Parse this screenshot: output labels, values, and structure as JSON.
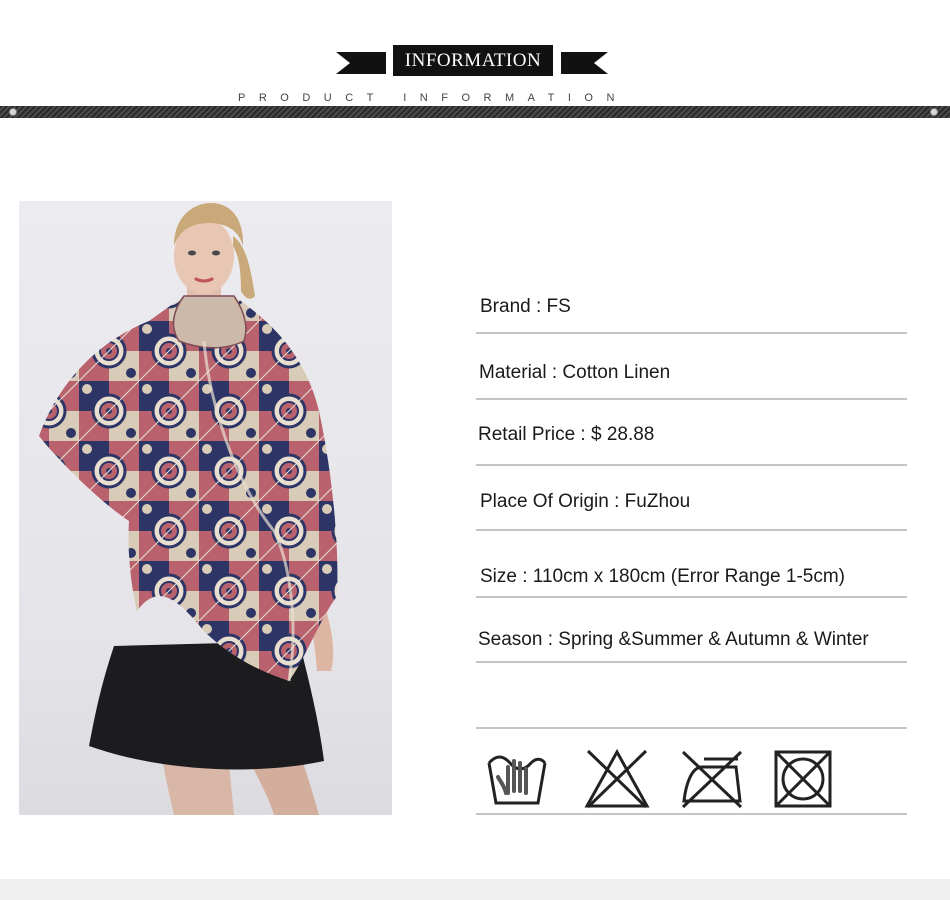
{
  "header": {
    "banner_title": "INFORMATION",
    "subtitle": "PRODUCT   INFORMATION"
  },
  "product_photo": {
    "description_icon": "model-wearing-scarf-image",
    "colors": {
      "navy": "#2d3566",
      "rose": "#b9626e",
      "cream": "#d8cbb8",
      "skirt": "#1c1c1e"
    }
  },
  "specs": [
    {
      "label": "Brand : FS"
    },
    {
      "label": "Material :  Cotton Linen"
    },
    {
      "label": "Retail Price : $ 28.88"
    },
    {
      "label": "Place Of Origin : FuZhou"
    },
    {
      "label": "Size : 110cm x 180cm (Error Range 1-5cm)"
    },
    {
      "label": "Season : Spring &Summer & Autumn & Winter"
    },
    {
      "label": ""
    }
  ],
  "care_icons": [
    {
      "name": "hand-wash-icon"
    },
    {
      "name": "do-not-bleach-icon"
    },
    {
      "name": "do-not-iron-icon"
    },
    {
      "name": "do-not-tumble-dry-icon"
    }
  ]
}
